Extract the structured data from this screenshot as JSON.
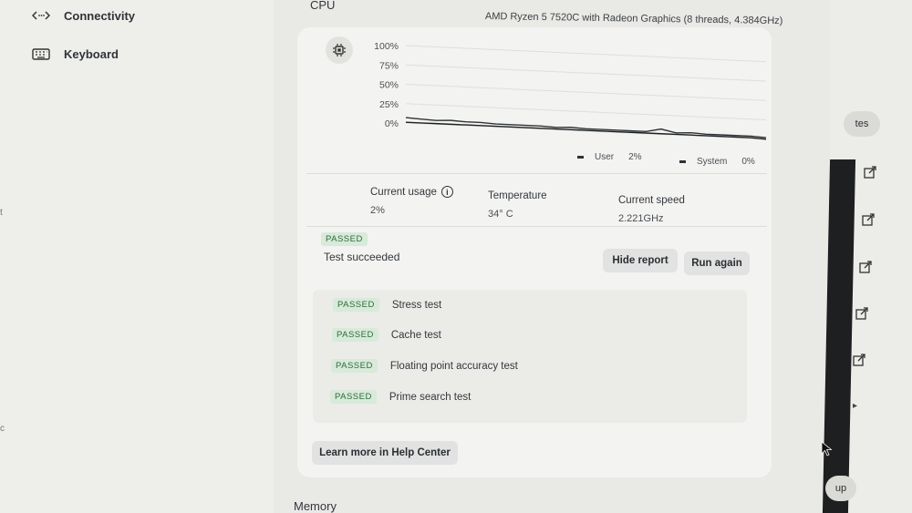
{
  "sidebar": {
    "items": [
      {
        "label": "Connectivity",
        "icon": "connectivity-icon"
      },
      {
        "label": "Keyboard",
        "icon": "keyboard-icon"
      }
    ],
    "edge_glyphs": [
      "t",
      "c"
    ]
  },
  "cpu": {
    "section_title": "CPU",
    "model": "AMD Ryzen 5 7520C with Radeon Graphics (8 threads, 4.384GHz)",
    "chart_data": {
      "type": "line",
      "y_tick_labels": [
        "100%",
        "75%",
        "50%",
        "25%",
        "0%"
      ],
      "ylim": [
        0,
        100
      ],
      "grid": true,
      "legend_position": "bottom-right",
      "series": [
        {
          "name": "User",
          "values": [
            7,
            6,
            5,
            6,
            5,
            5,
            4,
            4,
            4,
            4,
            3,
            4,
            3,
            3,
            3,
            3,
            3,
            7,
            3,
            4,
            3,
            3,
            3,
            3,
            2
          ]
        },
        {
          "name": "System",
          "values": [
            1,
            1,
            1,
            1,
            1,
            1,
            1,
            1,
            1,
            1,
            1,
            1,
            1,
            1,
            1,
            1,
            1,
            1,
            1,
            1,
            1,
            1,
            1,
            1,
            0
          ]
        }
      ],
      "legend": [
        {
          "name": "User",
          "value": "2%"
        },
        {
          "name": "System",
          "value": "0%"
        }
      ]
    },
    "stats": {
      "usage_label": "Current usage",
      "usage_value": "2%",
      "temp_label": "Temperature",
      "temp_value": "34° C",
      "speed_label": "Current speed",
      "speed_value": "2.221GHz"
    },
    "status_badge": "PASSED",
    "status_text": "Test succeeded",
    "hide_report_label": "Hide report",
    "run_again_label": "Run again",
    "results": [
      {
        "badge": "PASSED",
        "name": "Stress test"
      },
      {
        "badge": "PASSED",
        "name": "Cache test"
      },
      {
        "badge": "PASSED",
        "name": "Floating point accuracy test"
      },
      {
        "badge": "PASSED",
        "name": "Prime search test"
      }
    ],
    "help_label": "Learn more in Help Center"
  },
  "memory": {
    "section_title": "Memory"
  },
  "right": {
    "top_chip": "tes",
    "bottom_chip": "up"
  }
}
